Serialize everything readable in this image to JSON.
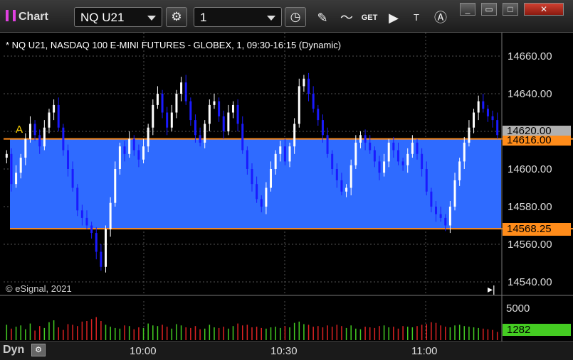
{
  "window": {
    "title": "Chart",
    "symbol_value": "NQ U21",
    "interval_value": "1",
    "minimize_icon": "minimize-icon",
    "restore_icon": "restore-icon",
    "maximize_icon": "maximize-icon",
    "close_icon": "close-icon"
  },
  "chart": {
    "title": "* NQ U21, NASDAQ 100 E-MINI FUTURES - GLOBEX, 1, 09:30-16:15 (Dynamic)",
    "copyright": "© eSignal, 2021",
    "marker": "A",
    "price_labels": [
      "14660.00",
      "14640.00",
      "14620.00",
      "14600.00",
      "14580.00",
      "14560.00",
      "14540.00"
    ],
    "last_price": "14620.00",
    "upper_level": "14616.00",
    "lower_level": "14568.25",
    "volume_top_label": "5000",
    "volume_last": "1282",
    "time_labels": [
      "10:00",
      "10:30",
      "11:00"
    ],
    "dyn_label": "Dyn",
    "colors": {
      "up": "#ffffff",
      "down": "#1a1aff",
      "range_fill": "#2f6bff",
      "level_line": "#ff8c1a",
      "vol_up": "#44cc22",
      "vol_down": "#dd2222",
      "grid": "#555555"
    }
  },
  "chart_data": {
    "type": "candlestick",
    "ylim": [
      14535,
      14670
    ],
    "y_ticks": [
      14540,
      14560,
      14580,
      14600,
      14620,
      14640,
      14660
    ],
    "closes": [
      14608,
      14592,
      14598,
      14606,
      14616,
      14624,
      14618,
      14612,
      14622,
      14630,
      14634,
      14622,
      14610,
      14600,
      14590,
      14578,
      14574,
      14570,
      14566,
      14556,
      14548,
      14568,
      14582,
      14600,
      14612,
      14608,
      14616,
      14610,
      14605,
      14612,
      14622,
      14634,
      14640,
      14630,
      14622,
      14630,
      14640,
      14646,
      14636,
      14626,
      14618,
      14614,
      14624,
      14634,
      14636,
      14628,
      14620,
      14630,
      14634,
      14624,
      14610,
      14600,
      14592,
      14584,
      14580,
      14590,
      14600,
      14608,
      14612,
      14604,
      14612,
      14624,
      14644,
      14648,
      14640,
      14632,
      14626,
      14618,
      14608,
      14600,
      14594,
      14588,
      14590,
      14602,
      14614,
      14618,
      14614,
      14610,
      14604,
      14598,
      14604,
      14614,
      14610,
      14604,
      14602,
      14608,
      14614,
      14608,
      14600,
      14588,
      14580,
      14576,
      14574,
      14570,
      14580,
      14594,
      14604,
      14614,
      14622,
      14630,
      14636,
      14632,
      14628,
      14626,
      14618
    ],
    "volumes": [
      2400,
      1800,
      2100,
      2300,
      1700,
      2600,
      1500,
      2200,
      1900,
      2800,
      3100,
      2000,
      1600,
      2500,
      2400,
      2200,
      2900,
      3000,
      3300,
      3600,
      3000,
      2400,
      2100,
      1900,
      1800,
      2300,
      2200,
      1700,
      2000,
      1900,
      2600,
      2300,
      2200,
      2400,
      2100,
      1800,
      2500,
      2300,
      2000,
      1900,
      2200,
      1700,
      1800,
      2400,
      2000,
      1900,
      2100,
      1800,
      2200,
      2600,
      2300,
      2400,
      2000,
      2100,
      1900,
      1800,
      2000,
      2100,
      1900,
      2200,
      2000,
      2700,
      2900,
      2500,
      2400,
      2100,
      2200,
      2000,
      2300,
      2100,
      2400,
      2200,
      1900,
      2300,
      1800,
      1700,
      2100,
      2000,
      1900,
      2200,
      2300,
      2000,
      2100,
      1800,
      2200,
      2100,
      2000,
      2200,
      2400,
      2500,
      2800,
      2700,
      2300,
      2100,
      2000,
      2300,
      2400,
      2200,
      2100,
      2000,
      1900,
      1800,
      1700,
      1600,
      1282
    ]
  }
}
